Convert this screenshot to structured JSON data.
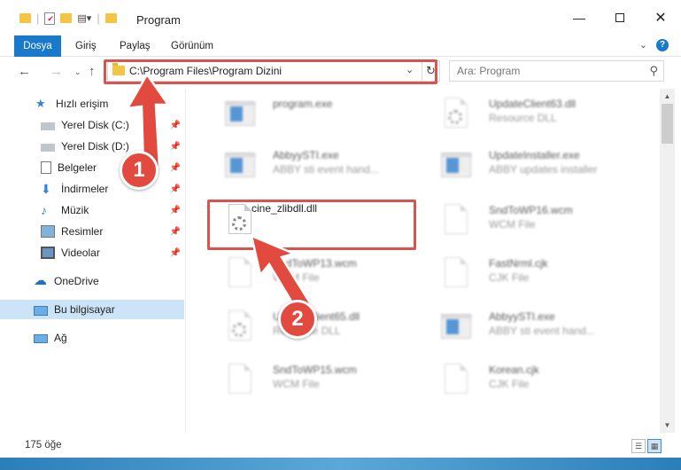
{
  "window": {
    "title": "Program",
    "minimize_icon": "minimize-icon",
    "maximize_icon": "maximize-icon",
    "close_icon": "close-icon"
  },
  "ribbon": {
    "tabs": [
      {
        "label": "Dosya"
      },
      {
        "label": "Giriş"
      },
      {
        "label": "Paylaş"
      },
      {
        "label": "Görünüm"
      }
    ]
  },
  "address": {
    "path": "C:\\Program Files\\Program Dizini"
  },
  "search": {
    "placeholder": "Ara: Program"
  },
  "sidebar": {
    "items": [
      {
        "label": "Hızlı erişim"
      },
      {
        "label": "Yerel Disk (C:)"
      },
      {
        "label": "Yerel Disk (D:)"
      },
      {
        "label": "Belgeler"
      },
      {
        "label": "İndirmeler"
      },
      {
        "label": "Müzik"
      },
      {
        "label": "Resimler"
      },
      {
        "label": "Videolar"
      },
      {
        "label": "OneDrive"
      },
      {
        "label": "Bu bilgisayar"
      },
      {
        "label": "Ağ"
      }
    ]
  },
  "files": [
    {
      "name": "program.exe",
      "type": ""
    },
    {
      "name": "UpdateClient63.dll",
      "type": "Resource DLL"
    },
    {
      "name": "AbbyySTI.exe",
      "type": "ABBY sti event hand..."
    },
    {
      "name": "UpdateInstaller.exe",
      "type": "ABBY updates installer"
    },
    {
      "name": "cine_zlibdll.dll",
      "type": ""
    },
    {
      "name": "SndToWP16.wcm",
      "type": "WCM File"
    },
    {
      "name": "SndToWP13.wcm",
      "type": "WCM File"
    },
    {
      "name": "FastNrml.cjk",
      "type": "CJK File"
    },
    {
      "name": "UpdateClient65.dll",
      "type": "Resource DLL"
    },
    {
      "name": "AbbyySTI.exe",
      "type": "ABBY sti event hand..."
    },
    {
      "name": "SndToWP15.wcm",
      "type": "WCM File"
    },
    {
      "name": "Korean.cjk",
      "type": "CJK File"
    }
  ],
  "status": {
    "count": "175 öğe"
  },
  "annotations": {
    "step1": "1",
    "step2": "2",
    "color": "#e34a3f"
  }
}
